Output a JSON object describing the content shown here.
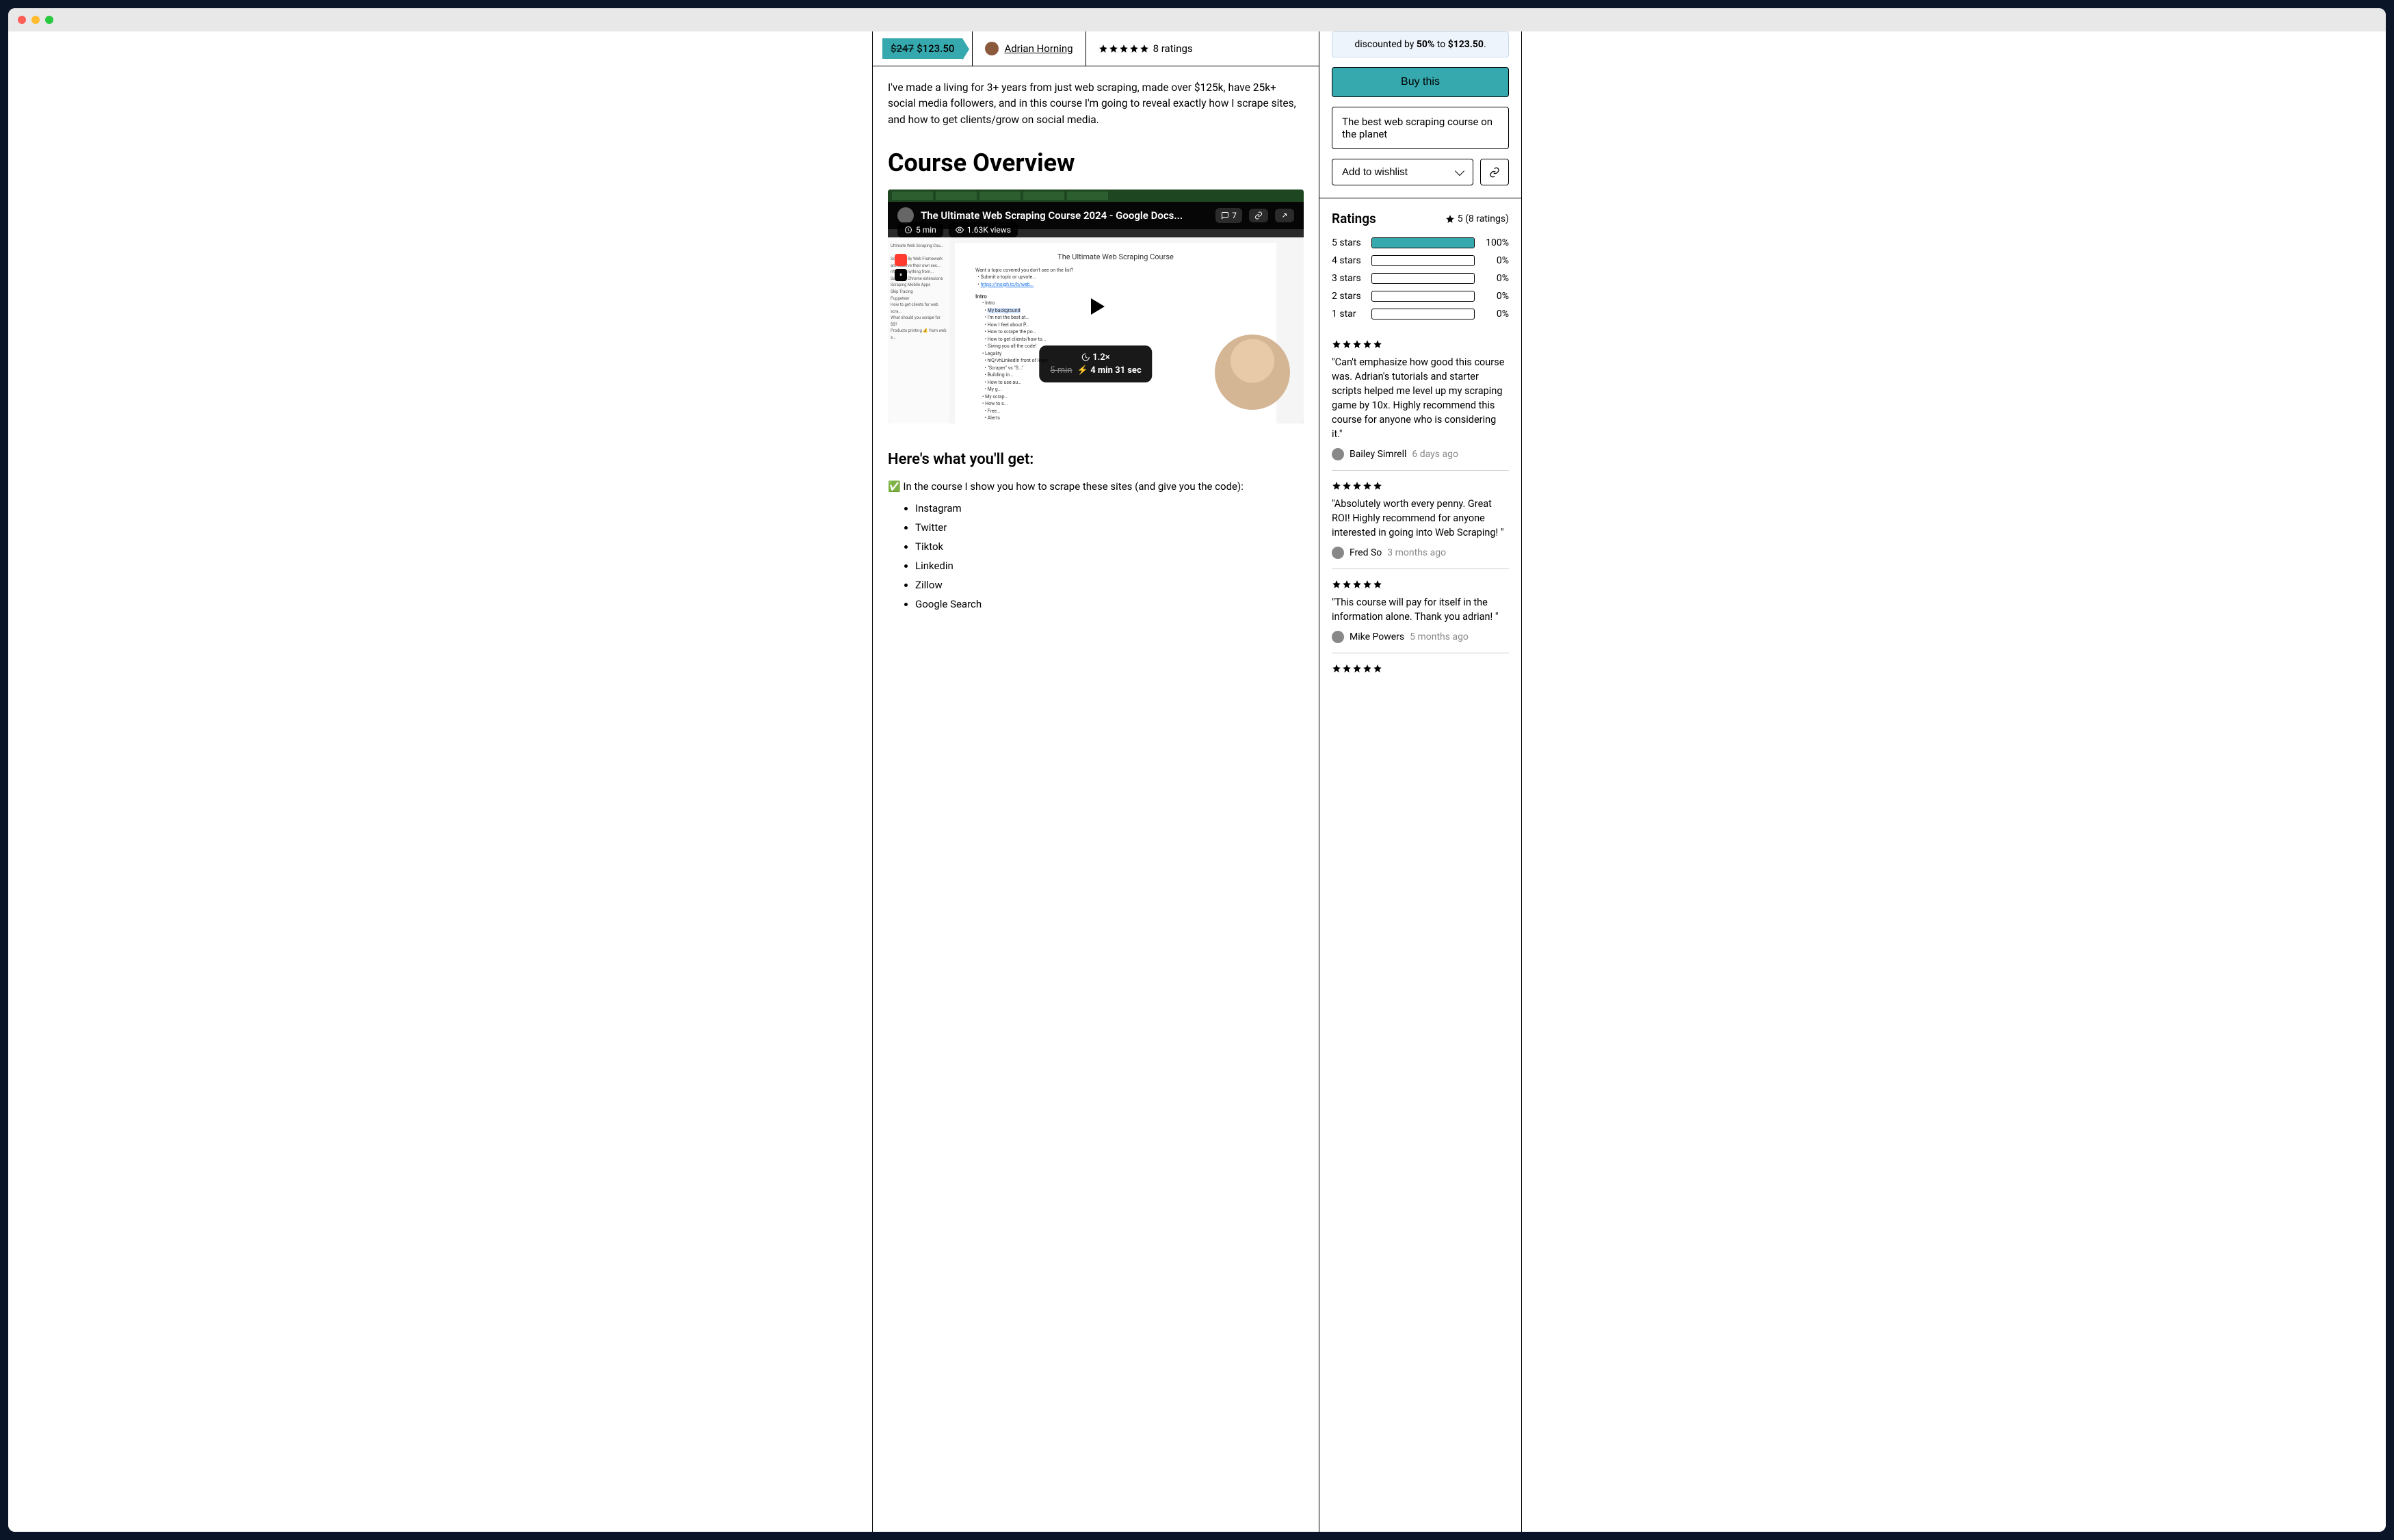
{
  "price": {
    "old": "$247",
    "new": "$123.50"
  },
  "author": "Adrian Horning",
  "ratings_count_text": "8 ratings",
  "intro": "I've made a living for 3+ years from just web scraping, made over $125k, have 25k+ social media followers, and in this course I'm going to reveal exactly how I scrape sites, and how to get clients/grow on social media.",
  "overview_heading": "Course Overview",
  "video": {
    "title": "The Ultimate Web Scraping Course 2024 - Google Docs...",
    "comments": "7",
    "duration": "5 min",
    "views": "1.63K views",
    "speed": "1.2×",
    "old_time": "5 min",
    "new_time": "4 min 31 sec",
    "doc_title": "The Ultimate Web Scraping Course"
  },
  "whats_included_heading": "Here's what you'll get:",
  "check_line": "In the course I show you how to scrape these sites (and give you the code):",
  "sites": [
    "Instagram",
    "Twitter",
    "Tiktok",
    "Linkedin",
    "Zillow",
    "Google Search"
  ],
  "discount": {
    "prefix": "discounted by ",
    "pct": "50%",
    "mid": " to ",
    "amount": "$123.50",
    "suffix": "."
  },
  "buy_label": "Buy this",
  "description": "The best web scraping course on the planet",
  "wishlist_label": "Add to wishlist",
  "ratings": {
    "heading": "Ratings",
    "summary": "5 (8 ratings)",
    "rows": [
      {
        "label": "5 stars",
        "pct": "100%",
        "fill": 100
      },
      {
        "label": "4 stars",
        "pct": "0%",
        "fill": 0
      },
      {
        "label": "3 stars",
        "pct": "0%",
        "fill": 0
      },
      {
        "label": "2 stars",
        "pct": "0%",
        "fill": 0
      },
      {
        "label": "1 star",
        "pct": "0%",
        "fill": 0
      }
    ]
  },
  "reviews": [
    {
      "text": "\"Can't emphasize how good this course was. Adrian's tutorials and starter scripts helped me level up my scraping game by 10x. Highly recommend this course for anyone who is considering it.\"",
      "author": "Bailey Simrell",
      "time": "6 days ago"
    },
    {
      "text": "\"Absolutely worth every penny. Great ROI! Highly recommend for anyone interested in going into Web Scraping! \"",
      "author": "Fred So",
      "time": "3 months ago"
    },
    {
      "text": "\"This course will pay for itself in the information alone. Thank you adrian! \"",
      "author": "Mike Powers",
      "time": "5 months ago"
    }
  ]
}
